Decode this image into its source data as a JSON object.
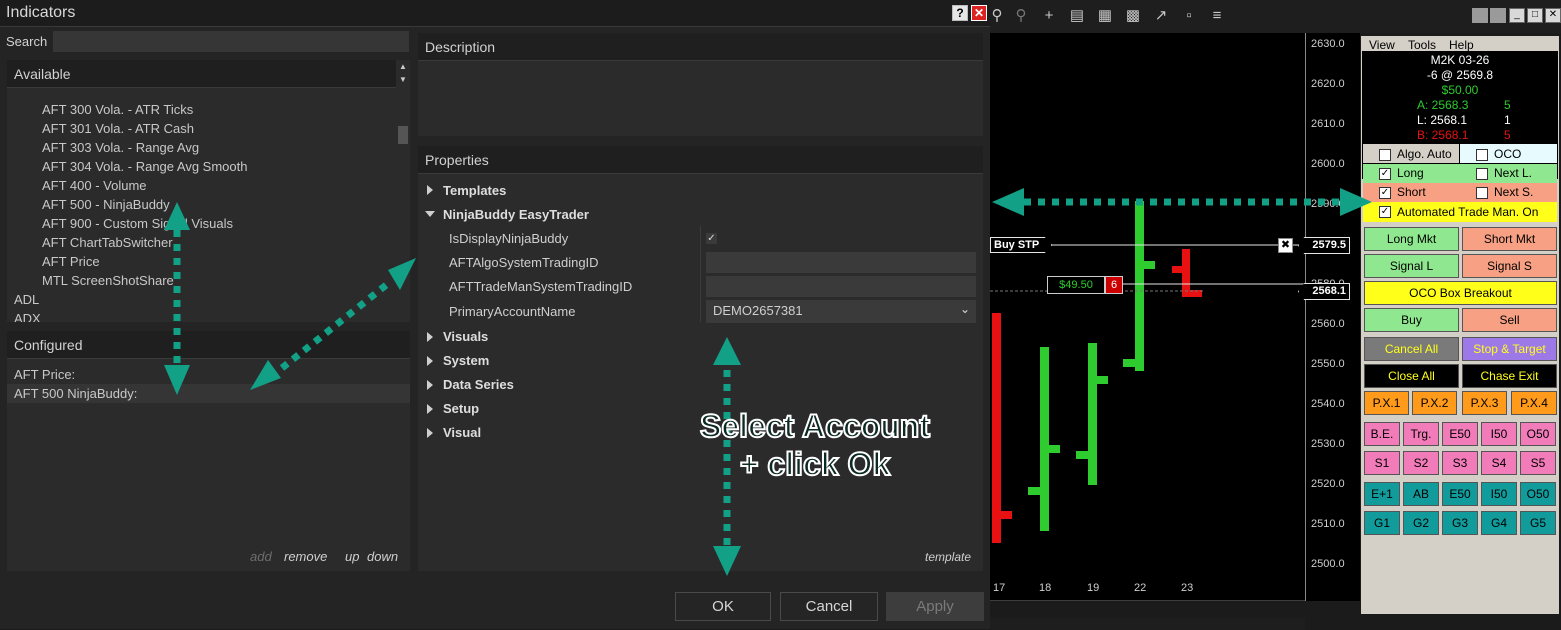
{
  "dialog": {
    "title": "Indicators",
    "help_btn": "?",
    "close_btn": "✕",
    "search_label": "Search",
    "search_value": "",
    "available_header": "Available",
    "available_items": [
      "AFT 300 Vola. - ATR Ticks",
      "AFT 301 Vola. - ATR Cash",
      "AFT 303 Vola. - Range Avg",
      "AFT 304 Vola. - Range Avg Smooth",
      "AFT 400 - Volume",
      "AFT 500 - NinjaBuddy",
      "AFT 900 - Custom Signal Visuals",
      "AFT ChartTabSwitcher",
      "AFT Price",
      "MTL ScreenShotShare",
      "ADL",
      "ADX"
    ],
    "configured_header": "Configured",
    "configured_items": [
      "AFT Price:",
      "AFT 500 NinjaBuddy:"
    ],
    "configured_actions": {
      "add": "add",
      "remove": "remove",
      "up": "up",
      "down": "down"
    },
    "description_header": "Description",
    "properties_header": "Properties",
    "groups": {
      "templates": "Templates",
      "ninjabuddy": "NinjaBuddy EasyTrader",
      "visuals": "Visuals",
      "system": "System",
      "data_series": "Data Series",
      "setup": "Setup",
      "visual": "Visual"
    },
    "props": {
      "is_display_label": "IsDisplayNinjaBuddy",
      "is_display_value": "✓",
      "algo_id_label": "AFTAlgoSystemTradingID",
      "algo_id_value": "",
      "trademan_id_label": "AFTTradeManSystemTradingID",
      "trademan_id_value": "",
      "account_label": "PrimaryAccountName",
      "account_value": "DEMO2657381"
    },
    "template_link": "template",
    "ok": "OK",
    "cancel": "Cancel",
    "apply": "Apply"
  },
  "annotation": {
    "line1": "Select Account",
    "line2": "+ click Ok",
    "color": "#12a086"
  },
  "chart": {
    "price_ticks": [
      "2630.0",
      "2620.0",
      "2610.0",
      "2600.0",
      "2590.0",
      "2580.0",
      "2570.0",
      "2560.0",
      "2550.0",
      "2540.0",
      "2530.0",
      "2520.0",
      "2510.0",
      "2500.0"
    ],
    "date_ticks": [
      "17",
      "18",
      "19",
      "22",
      "23"
    ],
    "buy_stp_label": "Buy STP",
    "buy_stp_price": "2579.5",
    "last_price": "2568.1",
    "pnl_label": "$49.50",
    "pnl_qty": "6",
    "bar_up_color": "#2ecc2e",
    "bar_down_color": "#e81010"
  },
  "trade_panel": {
    "menu": [
      "View",
      "Tools",
      "Help"
    ],
    "instrument": "M2K 03-26",
    "position": "-6 @ 2569.8",
    "pnl": "$50.00",
    "ask": "A: 2568.3",
    "ask_size": "5",
    "last": "L: 2568.1",
    "last_size": "1",
    "bid": "B: 2568.1",
    "bid_size": "5",
    "checks": {
      "algo_auto": "Algo. Auto",
      "oco": "OCO",
      "long": "Long",
      "next_l": "Next L.",
      "short": "Short",
      "next_s": "Next S.",
      "atm_on": "Automated Trade Man. On"
    },
    "buttons": {
      "long_mkt": "Long Mkt",
      "short_mkt": "Short Mkt",
      "signal_l": "Signal L",
      "signal_s": "Signal S",
      "oco_breakout": "OCO Box Breakout",
      "buy": "Buy",
      "sell": "Sell",
      "cancel_all": "Cancel All",
      "stop_target": "Stop & Target",
      "close_all": "Close All",
      "chase_exit": "Chase Exit"
    },
    "px_row": [
      "P.X.1",
      "P.X.2",
      "P.X.3",
      "P.X.4"
    ],
    "row_be": [
      "B.E.",
      "Trg.",
      "E50",
      "I50",
      "O50"
    ],
    "row_s": [
      "S1",
      "S2",
      "S3",
      "S4",
      "S5"
    ],
    "row_e": [
      "E+1",
      "AB",
      "E50",
      "I50",
      "O50"
    ],
    "row_g": [
      "G1",
      "G2",
      "G3",
      "G4",
      "G5"
    ]
  }
}
